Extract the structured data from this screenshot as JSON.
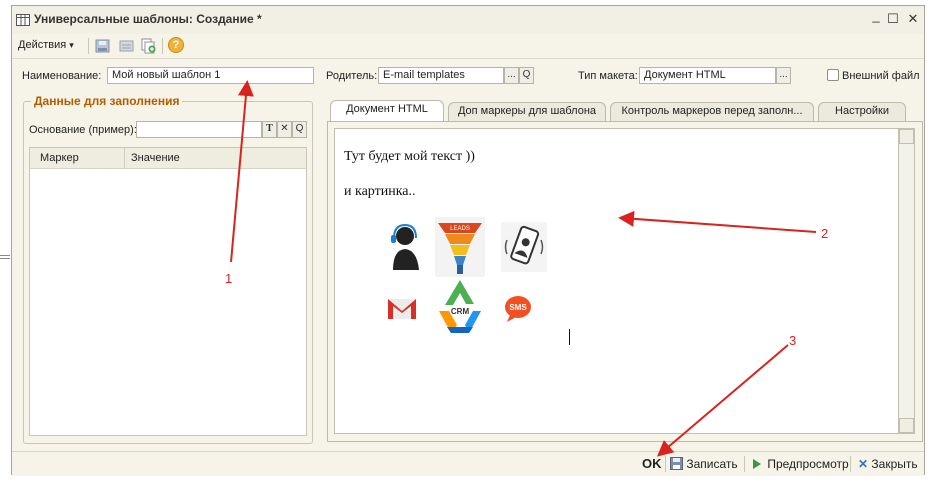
{
  "window": {
    "title": "Универсальные шаблоны: Создание *",
    "controls": {
      "minimize": "_",
      "maximize": "☐",
      "close": "✕"
    }
  },
  "toolbar": {
    "actions_label": "Действия",
    "actions_arrow": "▾",
    "help_glyph": "?"
  },
  "form": {
    "name_label": "Наименование:",
    "name_value": "Мой новый шаблон 1",
    "parent_label": "Родитель:",
    "parent_value": "E-mail templates",
    "parent_select_glyph": "...",
    "parent_search_glyph": "Q",
    "layout_type_label": "Тип макета:",
    "layout_type_value": "Документ HTML",
    "layout_type_select_glyph": "...",
    "external_file_label": "Внешний файл",
    "external_file_checked": false
  },
  "fill_data": {
    "group_title": "Данные для заполнения",
    "basis_label": "Основание (пример):",
    "basis_value": "",
    "basis_buttons": [
      "T",
      "✕",
      "Q"
    ],
    "table": {
      "columns": [
        "Маркер",
        "Значение"
      ],
      "rows": []
    }
  },
  "tabs": [
    {
      "label": "Документ HTML",
      "active": true
    },
    {
      "label": "Доп маркеры для шаблона",
      "active": false
    },
    {
      "label": "Контроль маркеров перед заполн...",
      "active": false
    },
    {
      "label": "Настройки",
      "active": false
    }
  ],
  "editor": {
    "line1": "Тут будет мой текст ))",
    "line2": "и картинка..",
    "images": {
      "funnel_label": "LEADS",
      "crm_label": "CRM",
      "sms_label": "SMS"
    }
  },
  "bottom_bar": {
    "ok_label": "OK",
    "save_label": "Записать",
    "preview_label": "Предпросмотр",
    "close_label": "Закрыть"
  },
  "annotations": {
    "numbers": [
      "1",
      "2",
      "3"
    ],
    "color": "#d8231f"
  }
}
